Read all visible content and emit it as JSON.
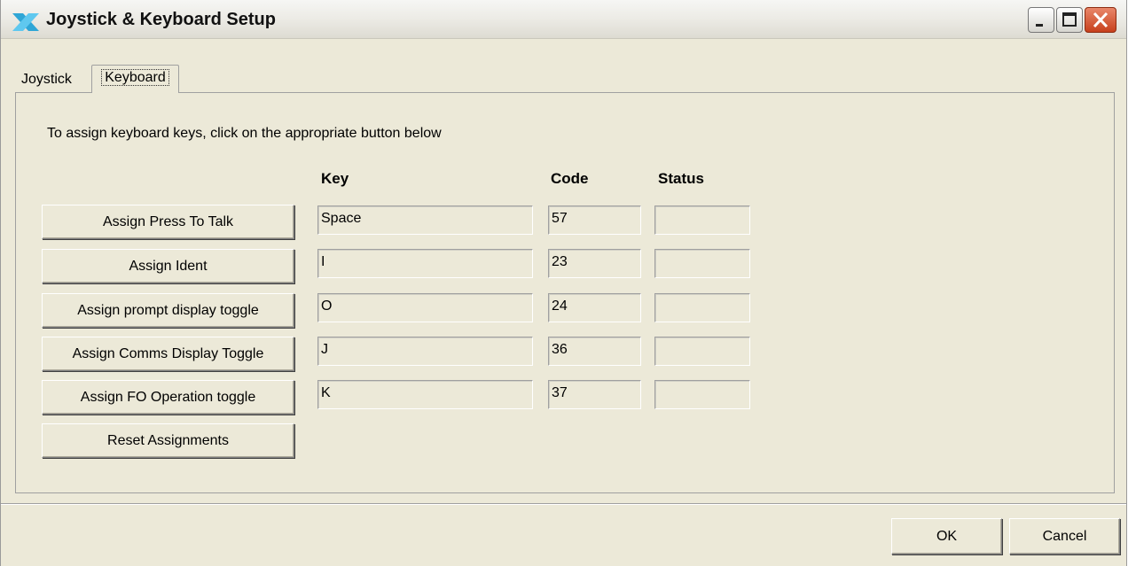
{
  "window": {
    "title": "Joystick & Keyboard Setup"
  },
  "tabs": [
    {
      "label": "Joystick",
      "selected": false
    },
    {
      "label": "Keyboard",
      "selected": true
    }
  ],
  "instructions": "To assign keyboard keys, click on the appropriate button below",
  "columns": {
    "key": "Key",
    "code": "Code",
    "status": "Status"
  },
  "rows": [
    {
      "button": "Assign Press To Talk",
      "key": "Space",
      "code": "57",
      "status": ""
    },
    {
      "button": "Assign Ident",
      "key": "I",
      "code": "23",
      "status": ""
    },
    {
      "button": "Assign prompt display toggle",
      "key": "O",
      "code": "24",
      "status": ""
    },
    {
      "button": "Assign Comms Display Toggle",
      "key": "J",
      "code": "36",
      "status": ""
    },
    {
      "button": "Assign FO Operation toggle",
      "key": "K",
      "code": "37",
      "status": ""
    }
  ],
  "reset_button": "Reset Assignments",
  "footer": {
    "ok": "OK",
    "cancel": "Cancel"
  },
  "icons": {
    "app": "app-logo-icon",
    "minimize": "minimize-icon",
    "maximize": "maximize-icon",
    "close": "close-icon"
  },
  "colors": {
    "close_button": "#c7401c",
    "app_icon": "#2fa6d6"
  }
}
